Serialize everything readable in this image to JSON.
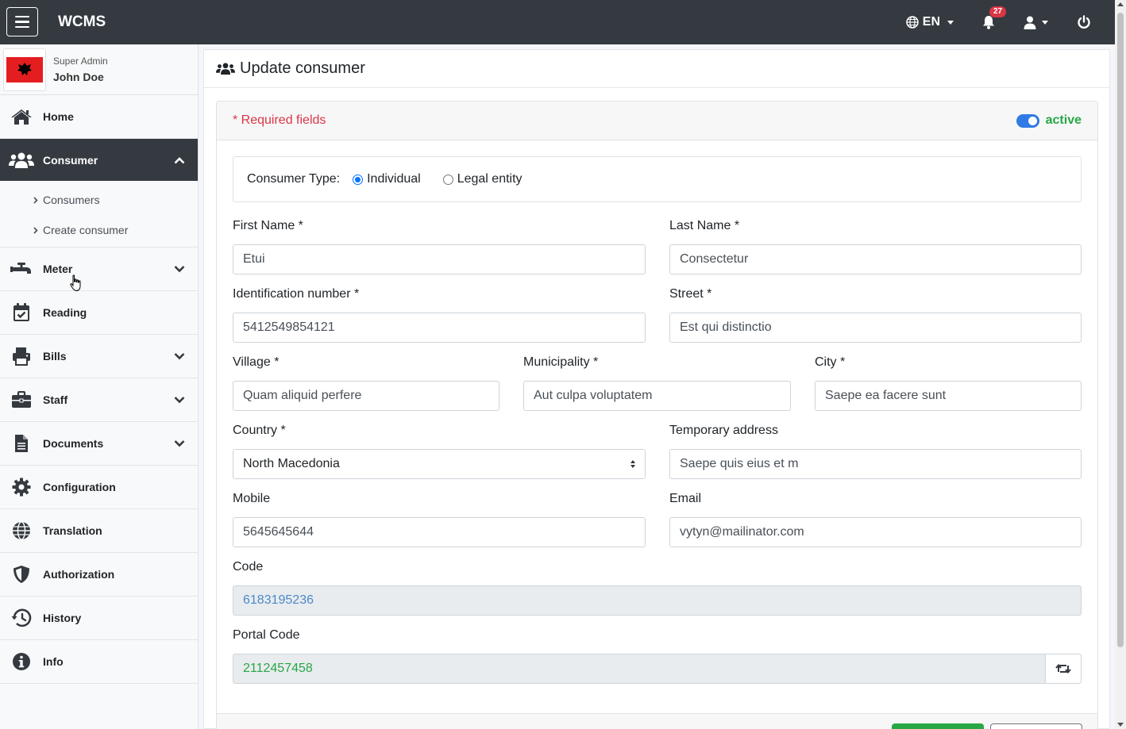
{
  "navbar": {
    "brand": "WCMS",
    "language": "EN",
    "notification_count": "27"
  },
  "sidebar": {
    "role": "Super Admin",
    "user_name": "John Doe",
    "items": [
      {
        "label": "Home",
        "icon": "home-icon"
      },
      {
        "label": "Consumer",
        "icon": "users-icon"
      },
      {
        "label": "Meter",
        "icon": "faucet-icon"
      },
      {
        "label": "Reading",
        "icon": "calendar-check-icon"
      },
      {
        "label": "Bills",
        "icon": "printer-icon"
      },
      {
        "label": "Staff",
        "icon": "briefcase-icon"
      },
      {
        "label": "Documents",
        "icon": "file-icon"
      },
      {
        "label": "Configuration",
        "icon": "gear-icon"
      },
      {
        "label": "Translation",
        "icon": "globe-icon"
      },
      {
        "label": "Authorization",
        "icon": "shield-icon"
      },
      {
        "label": "History",
        "icon": "history-icon"
      },
      {
        "label": "Info",
        "icon": "info-icon"
      }
    ],
    "consumer_sub": [
      "Consumers",
      "Create consumer"
    ]
  },
  "page": {
    "title": "Update consumer",
    "required_note": "* Required fields",
    "status_label": "active"
  },
  "form": {
    "consumer_type_label": "Consumer Type:",
    "type_individual": "Individual",
    "type_legal": "Legal entity",
    "first_name": {
      "label": "First Name *",
      "value": "Etui"
    },
    "last_name": {
      "label": "Last Name *",
      "value": "Consectetur"
    },
    "id_number": {
      "label": "Identification number *",
      "value": "5412549854121"
    },
    "street": {
      "label": "Street *",
      "value": "Est qui distinctio"
    },
    "village": {
      "label": "Village *",
      "value": "Quam aliquid perfere"
    },
    "municipality": {
      "label": "Municipality *",
      "value": "Aut culpa voluptatem"
    },
    "city": {
      "label": "City *",
      "value": "Saepe ea facere sunt"
    },
    "country": {
      "label": "Country *",
      "value": "North Macedonia"
    },
    "temp_address": {
      "label": "Temporary address",
      "value": "Saepe quis eius et m"
    },
    "mobile": {
      "label": "Mobile",
      "value": "5645645644"
    },
    "email": {
      "label": "Email",
      "value": "vytyn@mailinator.com"
    },
    "code": {
      "label": "Code",
      "value": "6183195236"
    },
    "portal_code": {
      "label": "Portal Code",
      "value": "2112457458"
    }
  },
  "colors": {
    "navbar": "#343a40",
    "active_green": "#28a745",
    "required_red": "#dc3545",
    "toggle_blue": "#2f7ae5"
  }
}
